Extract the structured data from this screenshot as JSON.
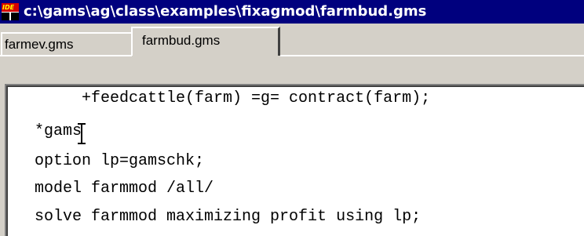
{
  "window": {
    "title": "c:\\gams\\ag\\class\\examples\\fixagmod\\farmbud.gms",
    "icon": "ide-icon",
    "icon_text": "IDE"
  },
  "tabs": [
    {
      "label": "farmev.gms",
      "active": false
    },
    {
      "label": "farmbud.gms",
      "active": true
    }
  ],
  "editor": {
    "lines": [
      "     +feedcattle(farm) =g= contract(farm);",
      "*gams",
      "option lp=gamschk;",
      "model farmmod /all/",
      "solve farmmod maximizing profit using lp;"
    ],
    "cursor": "text-cursor-icon"
  },
  "colors": {
    "titlebar": "#00007e",
    "chrome": "#d4d0c8",
    "editor_bg": "#ffffff"
  }
}
